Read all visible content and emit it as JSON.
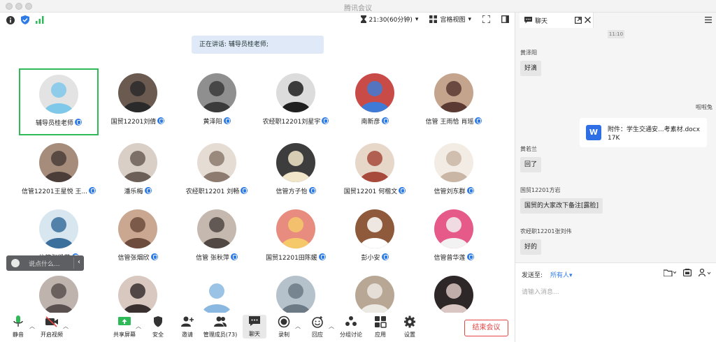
{
  "window": {
    "title": "腾讯会议"
  },
  "topbar": {
    "timer": "21:30(60分钟)",
    "view_mode": "宫格视图"
  },
  "speaking": {
    "label": "正在讲话: 辅导员桂老师;"
  },
  "participants": [
    {
      "name": "辅导员桂老师"
    },
    {
      "name": "国贸12201刘倩"
    },
    {
      "name": "黄泽阳"
    },
    {
      "name": "农经职12201刘星宇"
    },
    {
      "name": "南新彦"
    },
    {
      "name": "信管 王雨恰 肖瑶"
    },
    {
      "name": "信管12201王星悦 王..."
    },
    {
      "name": "潘乐梅"
    },
    {
      "name": "农经职12201 刘畅"
    },
    {
      "name": "信管方子怡"
    },
    {
      "name": "国贸12201 何楷文"
    },
    {
      "name": "信管刘东群"
    },
    {
      "name": "信管张凯莉"
    },
    {
      "name": "信管张烟欣"
    },
    {
      "name": "信管 张秋萍"
    },
    {
      "name": "国贸12201田陈媛"
    },
    {
      "name": "彭小安"
    },
    {
      "name": "信管曾华莲"
    },
    {
      "name": ""
    },
    {
      "name": ""
    },
    {
      "name": ""
    },
    {
      "name": ""
    },
    {
      "name": ""
    },
    {
      "name": ""
    }
  ],
  "chat_hint": {
    "placeholder": "说点什么..."
  },
  "toolbar": {
    "mute": "静音",
    "video": "开启视频",
    "share": "共享屏幕",
    "security": "安全",
    "invite": "邀请",
    "members": "管理成员(73)",
    "chat": "聊天",
    "record": "录制",
    "react": "回应",
    "breakout": "分组讨论",
    "apps": "应用",
    "settings": "设置",
    "end": "结束会议"
  },
  "chat": {
    "tab_label": "聊天",
    "time": "11:10",
    "messages": [
      {
        "sender": "黄泽阳",
        "text": "好滴"
      },
      {
        "sender": "啦啦兔",
        "file_name": "附件：学生交通安...考素材.docx",
        "file_size": "17K",
        "file_icon": "W"
      },
      {
        "sender": "黄若兰",
        "text": "回了"
      },
      {
        "sender": "国贸12201方岩",
        "text": "国贸的大家改下备注[露脸]"
      },
      {
        "sender": "农经职12201张刘伟",
        "text": "好的"
      }
    ],
    "send_to_label": "发送至:",
    "recipient": "所有人",
    "input_placeholder": "请输入消息..."
  },
  "colors": {
    "accent_blue": "#2f7be6",
    "speaking_green": "#2fba58",
    "end_red": "#e34545"
  }
}
